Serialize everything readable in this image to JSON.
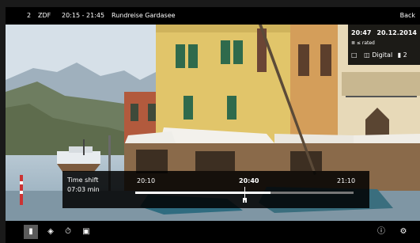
{
  "topbar": {
    "channel_number": "2",
    "channel_name": "ZDF",
    "time_range": "20:15 - 21:45",
    "program_title": "Rundreise Gardasee",
    "back_label": "Back"
  },
  "info_panel": {
    "time": "20:47",
    "date": "20.12.2014",
    "icons_row": "≣ ≤ rated",
    "digital_label": "Digital",
    "audio_channels": "2"
  },
  "timeshift": {
    "label": "Time shift",
    "duration": "07:03 min",
    "time_start": "20:10",
    "time_current": "20:40",
    "time_end": "21:10",
    "buffered_fraction": 0.62,
    "position_fraction": 0.5
  },
  "toolbar": {
    "icons": [
      "bookmark-icon",
      "record-icon",
      "timer-icon",
      "tv-icon",
      "info-icon",
      "settings-icon"
    ]
  }
}
